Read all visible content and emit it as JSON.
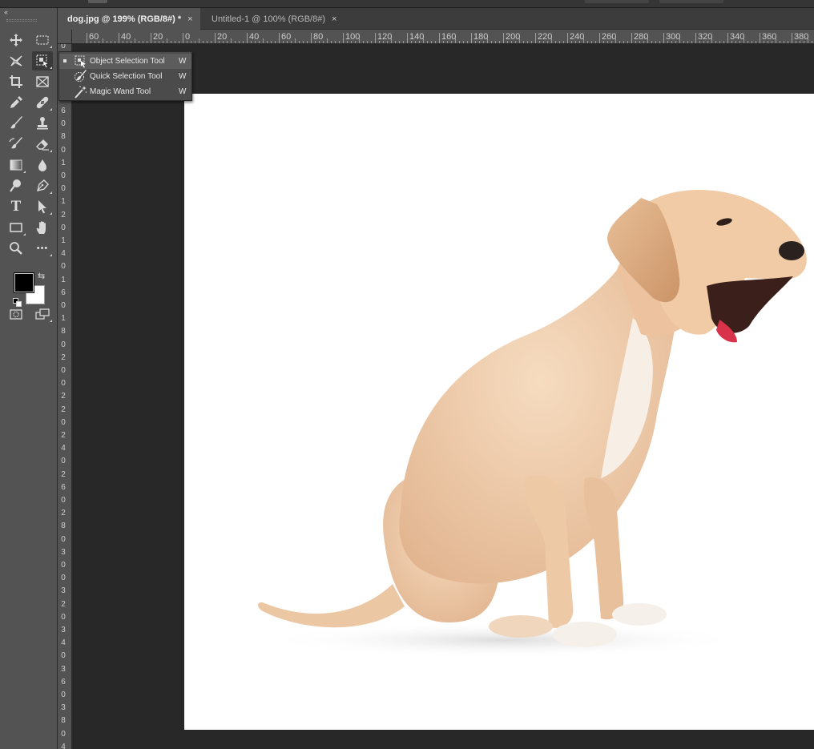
{
  "tabs": [
    {
      "label": "dog.jpg @ 199% (RGB/8#) *",
      "active": true
    },
    {
      "label": "Untitled-1 @ 100% (RGB/8#)",
      "active": false
    }
  ],
  "tab_close_glyph": "×",
  "toolbar": {
    "collapse_glyph": "‹‹",
    "tools": [
      {
        "icon": "move-icon"
      },
      {
        "icon": "rectangular-marquee-icon"
      },
      {
        "icon": "lasso-icon"
      },
      {
        "icon": "object-selection-icon"
      },
      {
        "icon": "crop-icon"
      },
      {
        "icon": "frame-icon"
      },
      {
        "icon": "eyedropper-icon"
      },
      {
        "icon": "healing-brush-icon"
      },
      {
        "icon": "brush-icon"
      },
      {
        "icon": "clone-stamp-icon"
      },
      {
        "icon": "history-brush-icon"
      },
      {
        "icon": "eraser-icon"
      },
      {
        "icon": "gradient-icon"
      },
      {
        "icon": "blur-icon"
      },
      {
        "icon": "dodge-icon"
      },
      {
        "icon": "pen-icon"
      },
      {
        "icon": "type-icon"
      },
      {
        "icon": "path-selection-icon"
      },
      {
        "icon": "rectangle-shape-icon"
      },
      {
        "icon": "hand-icon"
      },
      {
        "icon": "zoom-icon"
      },
      {
        "icon": "more-tools-icon"
      }
    ],
    "type_glyph": "T",
    "more_glyph": "•••",
    "swap_glyph": "⇆",
    "foreground_color": "#000000",
    "background_color": "#ffffff"
  },
  "flyout": {
    "items": [
      {
        "label": "Object Selection Tool",
        "shortcut": "W",
        "icon": "object-selection-icon",
        "selected": true
      },
      {
        "label": "Quick Selection Tool",
        "shortcut": "W",
        "icon": "quick-selection-icon",
        "selected": false
      },
      {
        "label": "Magic Wand Tool",
        "shortcut": "W",
        "icon": "magic-wand-icon",
        "selected": false
      }
    ]
  },
  "rulers": {
    "horizontal_labels": [
      "60",
      "40",
      "20",
      "0",
      "20",
      "40",
      "60",
      "80",
      "100",
      "120",
      "140",
      "160",
      "180",
      "200",
      "220",
      "240",
      "260",
      "280",
      "300",
      "320",
      "340",
      "360",
      "380"
    ],
    "vertical_labels": [
      "0",
      "2",
      "0",
      "4",
      "0",
      "6",
      "0",
      "8",
      "0",
      "1",
      "0",
      "0",
      "1",
      "2",
      "0",
      "1",
      "4",
      "0",
      "1",
      "6",
      "0",
      "1",
      "8",
      "0",
      "2",
      "0",
      "0",
      "2",
      "2",
      "0",
      "2",
      "4",
      "0",
      "2",
      "6",
      "0",
      "2",
      "8",
      "0",
      "3",
      "0",
      "0",
      "3",
      "2",
      "0",
      "3",
      "4",
      "0",
      "3",
      "6",
      "0",
      "3",
      "8",
      "0",
      "4"
    ]
  },
  "document": {
    "background": "#ffffff",
    "subject": "dog-photo"
  }
}
